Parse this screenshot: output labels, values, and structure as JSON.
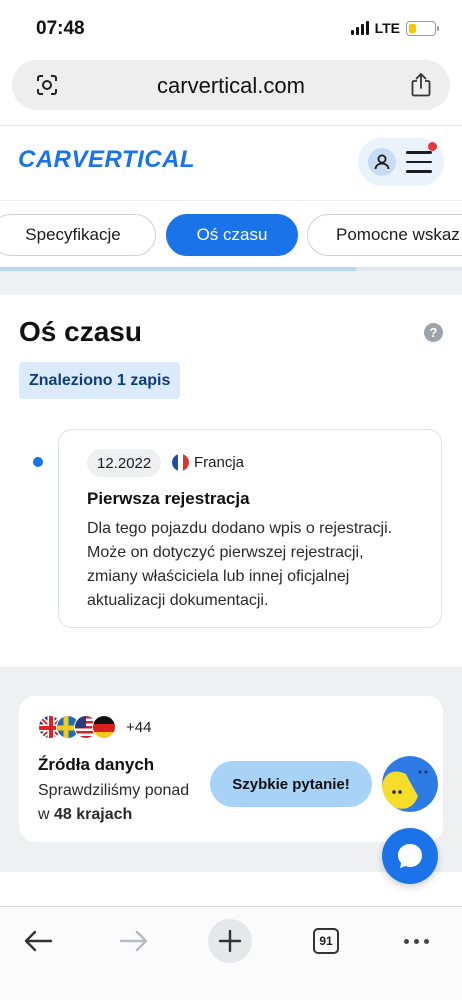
{
  "status_bar": {
    "time": "07:48",
    "network": "LTE",
    "battery_level": 0.3
  },
  "browser": {
    "url": "carvertical.com",
    "left_icon": "lens-icon",
    "right_icon": "share-icon"
  },
  "site_header": {
    "logo_text": "CARVERTICAL",
    "account_icon": "person-icon",
    "menu_icon": "hamburger-icon",
    "notification_color": "#e53935"
  },
  "tabs": [
    {
      "label": "Specyfikacje",
      "active": false
    },
    {
      "label": "Oś czasu",
      "active": true
    },
    {
      "label": "Pomocne wskaz",
      "active": false
    }
  ],
  "scroll_progress": 0.77,
  "timeline": {
    "title": "Oś czasu",
    "help_icon": "?",
    "found_badge": "Znaleziono 1 zapis",
    "events": [
      {
        "date": "12.2022",
        "country": "Francja",
        "title": "Pierwsza rejestracja",
        "description": "Dla tego pojazdu dodano wpis o rejestracji. Może on dotyczyć pierwszej rejestracji, zmiany właściciela lub innej oficjalnej aktualizacji dokumentacji."
      }
    ]
  },
  "sources": {
    "flags": [
      "uk-flag-icon",
      "sweden-flag-icon",
      "usa-flag-icon",
      "germany-flag-icon"
    ],
    "extra_count": "+44",
    "title": "Źródła danych",
    "desc_prefix": "Sprawdziliśmy ponad",
    "desc_bold_prefix": "w ",
    "desc_bold": "48 krajach"
  },
  "chat": {
    "quick_question": "Szybkie pytanie!",
    "chat_icon": "chat-bubble-icon"
  },
  "toolbar": {
    "tabs_count": "91"
  },
  "colors": {
    "accent": "#1a73e8",
    "badge_bg": "#dbeafc",
    "badge_text": "#0d3c7d"
  }
}
